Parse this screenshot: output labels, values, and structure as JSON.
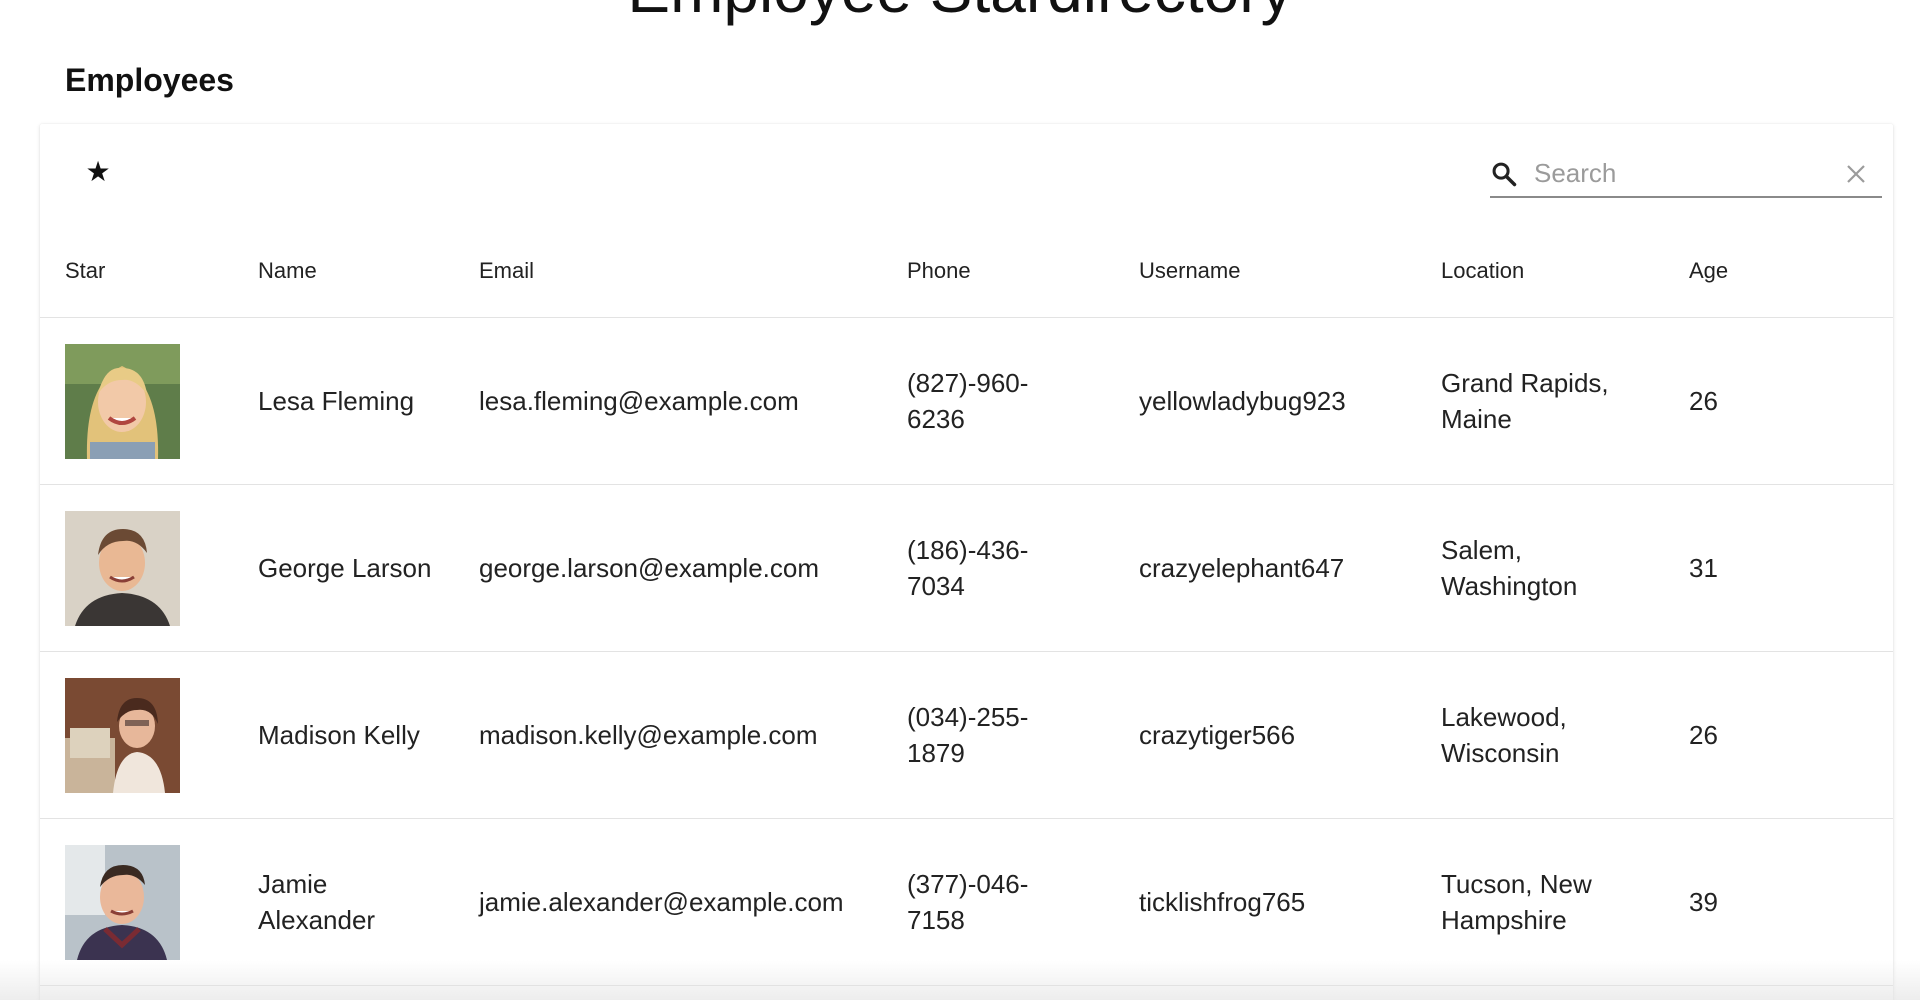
{
  "page": {
    "title": "Employee Stardirectory",
    "section_title": "Employees"
  },
  "toolbar": {
    "star_filter_icon": "star-icon",
    "search": {
      "placeholder": "Search",
      "value": "",
      "icon": "search-icon",
      "clear_icon": "close-icon"
    }
  },
  "table": {
    "columns": [
      "Star",
      "Name",
      "Email",
      "Phone",
      "Username",
      "Location",
      "Age"
    ],
    "rows": [
      {
        "avatar": "avatar-photo",
        "name": "Lesa Fleming",
        "email": "lesa.fleming@example.com",
        "phone": "(827)-960-6236",
        "username": "yellowladybug923",
        "location": "Grand Rapids, Maine",
        "age": "26"
      },
      {
        "avatar": "avatar-photo",
        "name": "George Larson",
        "email": "george.larson@example.com",
        "phone": "(186)-436-7034",
        "username": "crazyelephant647",
        "location": "Salem, Washington",
        "age": "31"
      },
      {
        "avatar": "avatar-photo",
        "name": "Madison Kelly",
        "email": "madison.kelly@example.com",
        "phone": "(034)-255-1879",
        "username": "crazytiger566",
        "location": "Lakewood, Wisconsin",
        "age": "26"
      },
      {
        "avatar": "avatar-photo",
        "name": "Jamie Alexander",
        "email": "jamie.alexander@example.com",
        "phone": "(377)-046-7158",
        "username": "ticklishfrog765",
        "location": "Tucson, New Hampshire",
        "age": "39"
      }
    ]
  },
  "colors": {
    "text": "#222222",
    "divider": "#e3e3e3",
    "search_underline": "#8a8a8a",
    "placeholder": "#9b9b9b"
  }
}
